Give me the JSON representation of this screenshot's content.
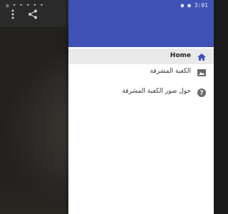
{
  "status_bar": {
    "left_text": "≥ • • • • •",
    "right_text": "● ● 3:01"
  },
  "toolbar": {
    "more_icon": "more-vertical-icon",
    "share_icon": "share-icon"
  },
  "drawer": {
    "header_color": "#3f51b5",
    "items": [
      {
        "label": "Home",
        "icon": "home-icon",
        "active": true
      },
      {
        "label": "الكعبة المشرفة",
        "icon": "image-icon",
        "active": false
      },
      {
        "label": "حول صور الكعبة المشرفة",
        "icon": "help-icon",
        "active": false
      }
    ]
  }
}
